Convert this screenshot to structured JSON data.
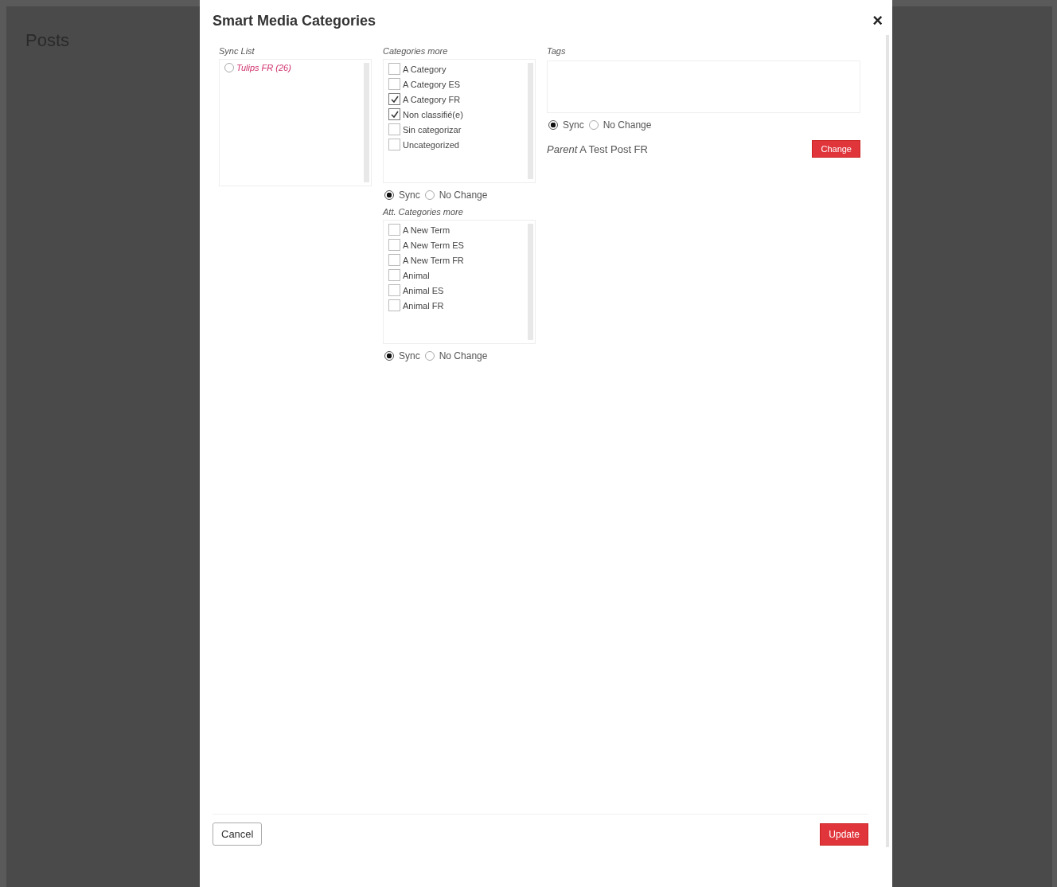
{
  "background": {
    "heading": "Posts"
  },
  "modal": {
    "title": "Smart Media Categories",
    "close": "×",
    "sync_list": {
      "label": "Sync List",
      "items": [
        {
          "label": "Tulips FR (26)",
          "selected": false
        }
      ]
    },
    "categories": {
      "label": "Categories more",
      "items": [
        {
          "label": "A Category",
          "checked": false
        },
        {
          "label": "A Category ES",
          "checked": false
        },
        {
          "label": "A Category FR",
          "checked": true
        },
        {
          "label": "Non classifié(e)",
          "checked": true
        },
        {
          "label": "Sin categorizar",
          "checked": false
        },
        {
          "label": "Uncategorized",
          "checked": false
        }
      ],
      "options": [
        {
          "label": "Sync",
          "selected": true
        },
        {
          "label": "No Change",
          "selected": false
        }
      ]
    },
    "att_categories": {
      "label": "Att. Categories more",
      "items": [
        {
          "label": "A New Term",
          "checked": false
        },
        {
          "label": "A New Term ES",
          "checked": false
        },
        {
          "label": "A New Term FR",
          "checked": false
        },
        {
          "label": "Animal",
          "checked": false
        },
        {
          "label": "Animal ES",
          "checked": false
        },
        {
          "label": "Animal FR",
          "checked": false
        }
      ],
      "options": [
        {
          "label": "Sync",
          "selected": true
        },
        {
          "label": "No Change",
          "selected": false
        }
      ]
    },
    "tags": {
      "label": "Tags",
      "options": [
        {
          "label": "Sync",
          "selected": true
        },
        {
          "label": "No Change",
          "selected": false
        }
      ]
    },
    "parent": {
      "text": "*Parent* A Test Post FR",
      "button": "Change"
    },
    "buttons": {
      "cancel": "Cancel",
      "update": "Update"
    }
  }
}
